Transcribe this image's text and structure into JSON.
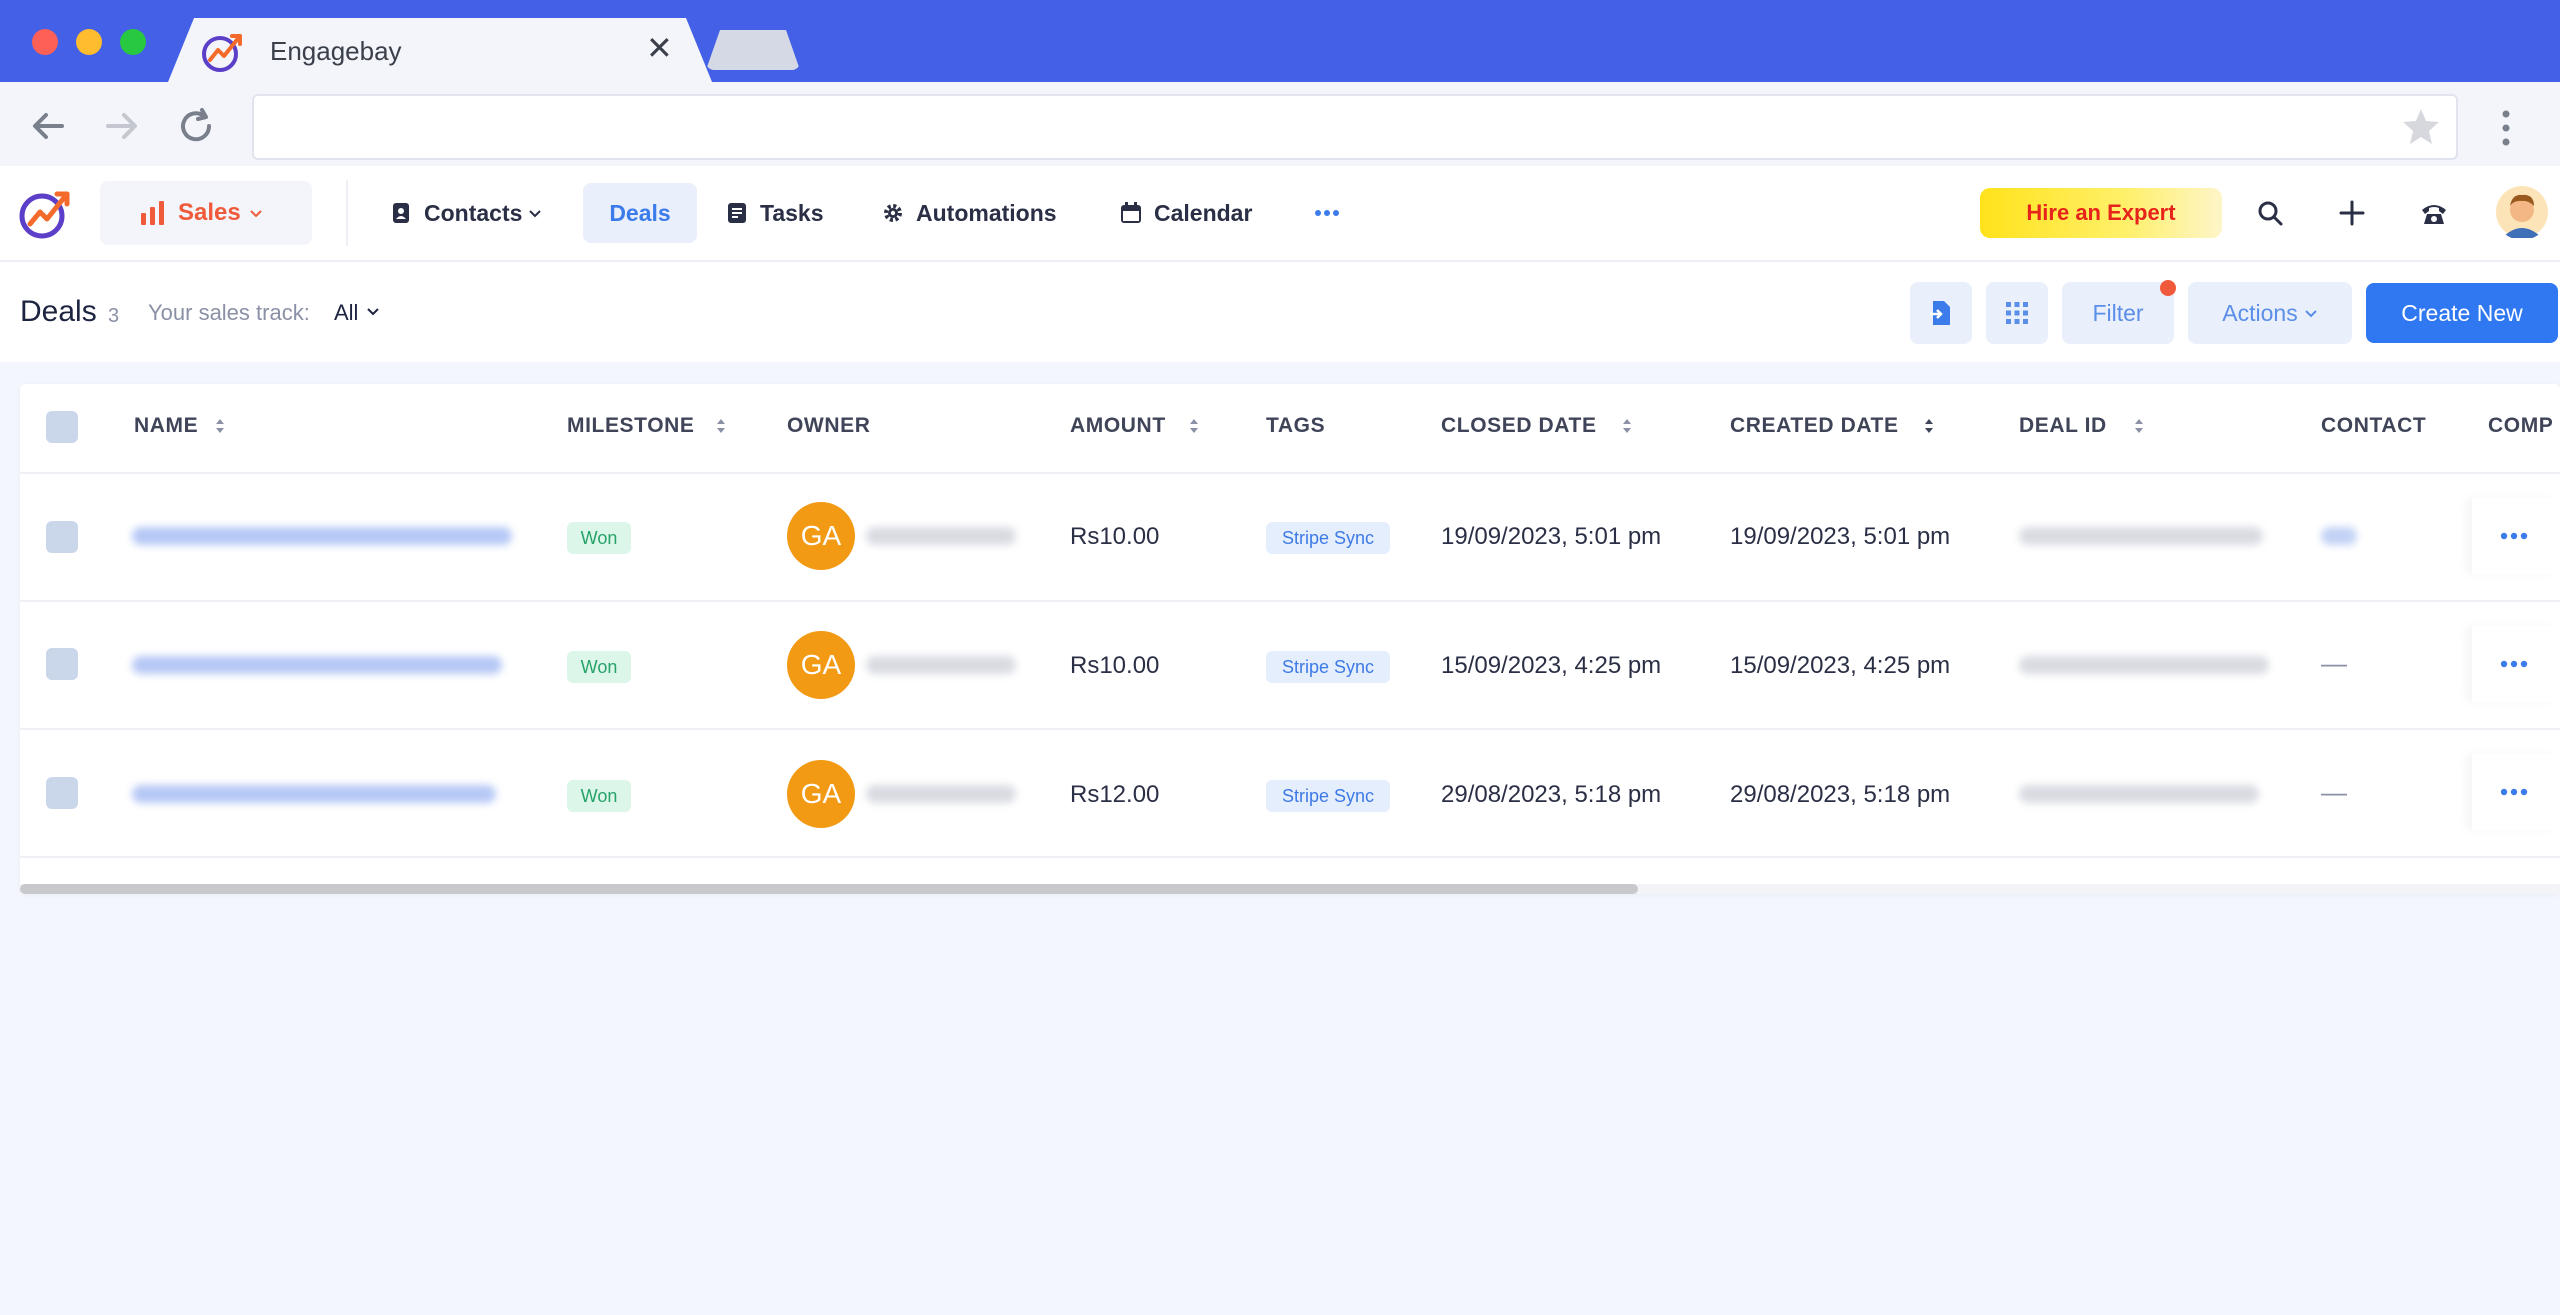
{
  "browser": {
    "tab_title": "Engagebay",
    "url": ""
  },
  "header": {
    "module_label": "Sales",
    "nav": [
      {
        "label": "Contacts"
      },
      {
        "label": "Deals"
      },
      {
        "label": "Tasks"
      },
      {
        "label": "Automations"
      },
      {
        "label": "Calendar"
      }
    ],
    "hire_label": "Hire an Expert"
  },
  "subheader": {
    "title": "Deals",
    "count": "3",
    "track_label": "Your sales track:",
    "track_value": "All",
    "filter_label": "Filter",
    "actions_label": "Actions",
    "create_label": "Create New"
  },
  "table": {
    "columns": [
      "NAME",
      "MILESTONE",
      "OWNER",
      "AMOUNT",
      "TAGS",
      "CLOSED DATE",
      "CREATED DATE",
      "DEAL ID",
      "CONTACT",
      "COMP"
    ],
    "rows": [
      {
        "milestone": "Won",
        "owner_initials": "GA",
        "amount": "Rs10.00",
        "tag": "Stripe Sync",
        "closed": "19/09/2023, 5:01 pm",
        "created": "19/09/2023, 5:01 pm",
        "contact": ""
      },
      {
        "milestone": "Won",
        "owner_initials": "GA",
        "amount": "Rs10.00",
        "tag": "Stripe Sync",
        "closed": "15/09/2023, 4:25 pm",
        "created": "15/09/2023, 4:25 pm",
        "contact": "—"
      },
      {
        "milestone": "Won",
        "owner_initials": "GA",
        "amount": "Rs12.00",
        "tag": "Stripe Sync",
        "closed": "29/08/2023, 5:18 pm",
        "created": "29/08/2023, 5:18 pm",
        "contact": "—"
      }
    ]
  },
  "colors": {
    "accent": "#2f78f2",
    "sales": "#ef5b3a",
    "won": "#27a36a",
    "avatar": "#f29a14"
  }
}
